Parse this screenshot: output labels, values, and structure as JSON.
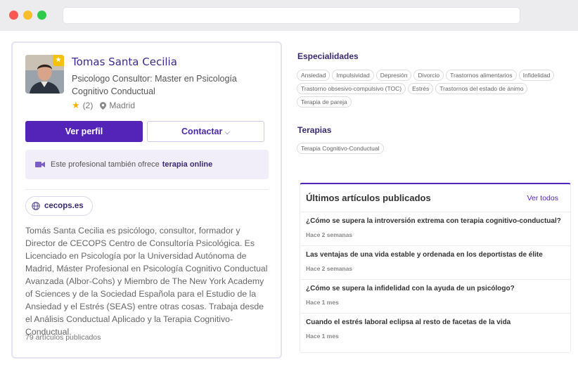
{
  "profile": {
    "name": "Tomas Santa Cecilia",
    "role": "Psicologo Consultor: Master en Psicología Cognitivo Conductual",
    "rating_count": "(2)",
    "location": "Madrid",
    "view_profile_label": "Ver perfil",
    "contact_label": "Contactar",
    "online_text": "Este profesional también ofrece",
    "online_bold": "terapia online",
    "website": "cecops.es",
    "bio": "Tomás Santa Cecilia es psicólogo, consultor, formador y Director de CECOPS Centro de Consultoría Psicológica. Es Licenciado en Psicología por la Universidad Autónoma de Madrid, Máster Profesional en Psicología Cognitivo Conductual Avanzada (Albor-Cohs) y Miembro de The New York Academy of Sciences y de la Sociedad Española para el Estudio de la Ansiedad y el Estrés (SEAS) entre otras cosas. Trabaja desde el Análisis Conductual Aplicado y la Terapia Cognitivo-Conductual.",
    "articles_count": "79 artículos publicados"
  },
  "specialties": {
    "title": "Especialidades",
    "items": [
      "Ansiedad",
      "Impulsividad",
      "Depresión",
      "Divorcio",
      "Trastornos alimentarios",
      "Infidelidad",
      "Trastorno obsesivo-compulsivo (TOC)",
      "Estrés",
      "Trastornos del estado de ánimo",
      "Terapia de pareja"
    ]
  },
  "therapies": {
    "title": "Terapias",
    "items": [
      "Terapia Cognitivo-Conductual"
    ]
  },
  "articles": {
    "title": "Últimos artículos publicados",
    "see_all": "Ver todos",
    "items": [
      {
        "title": "¿Cómo se supera la introversión extrema con terapia cognitivo-conductual?",
        "time": "Hace 2 semanas"
      },
      {
        "title": "Las ventajas de una vida estable y ordenada en los deportistas de élite",
        "time": "Hace 2 semanas"
      },
      {
        "title": "¿Cómo se supera la infidelidad con la ayuda de un psicólogo?",
        "time": "Hace 1 mes"
      },
      {
        "title": "Cuando el estrés laboral eclipsa al resto de facetas de la vida",
        "time": "Hace 1 mes"
      }
    ]
  },
  "colors": {
    "accent": "#5424b8",
    "star": "#f4b400"
  }
}
